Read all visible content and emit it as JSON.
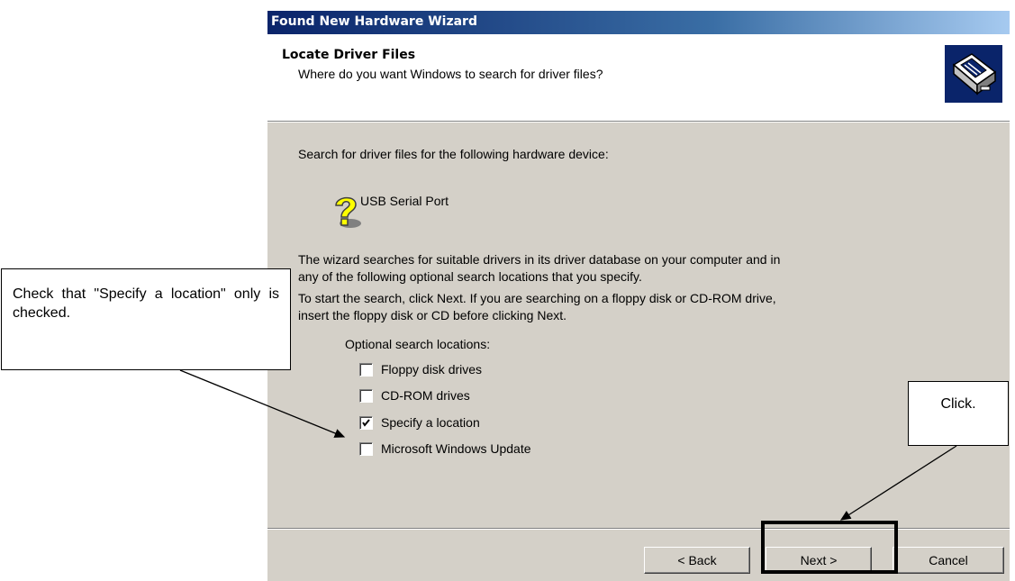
{
  "window": {
    "title": "Found New Hardware Wizard"
  },
  "header": {
    "title": "Locate Driver Files",
    "subtitle": "Where do you want Windows to search for driver files?",
    "icon": "hardware-driver-icon"
  },
  "body": {
    "intro": "Search for driver files for the following hardware device:",
    "device": {
      "name": "USB Serial Port",
      "icon": "unknown-device-icon"
    },
    "description_line1": "The wizard searches for suitable drivers in its driver database on your computer and in",
    "description_line2": "any of the following optional search locations that you specify.",
    "instructions_line1": "To start the search, click Next. If you are searching on a floppy disk or CD-ROM drive,",
    "instructions_line2": "insert the floppy disk or CD before clicking Next.",
    "options_label": "Optional search locations:",
    "options": [
      {
        "label": "Floppy disk drives",
        "checked": false
      },
      {
        "label": "CD-ROM drives",
        "checked": false
      },
      {
        "label": "Specify a location",
        "checked": true
      },
      {
        "label": "Microsoft Windows Update",
        "checked": false
      }
    ]
  },
  "buttons": {
    "back": "< Back",
    "next": "Next >",
    "cancel": "Cancel"
  },
  "annotations": {
    "left_callout": "Check that \"Specify a location\" only is checked.",
    "right_callout": "Click."
  },
  "colors": {
    "titlebar_start": "#0a246a",
    "titlebar_end": "#a6caf0",
    "dialog_face": "#d4d0c8",
    "header_background": "#ffffff"
  }
}
